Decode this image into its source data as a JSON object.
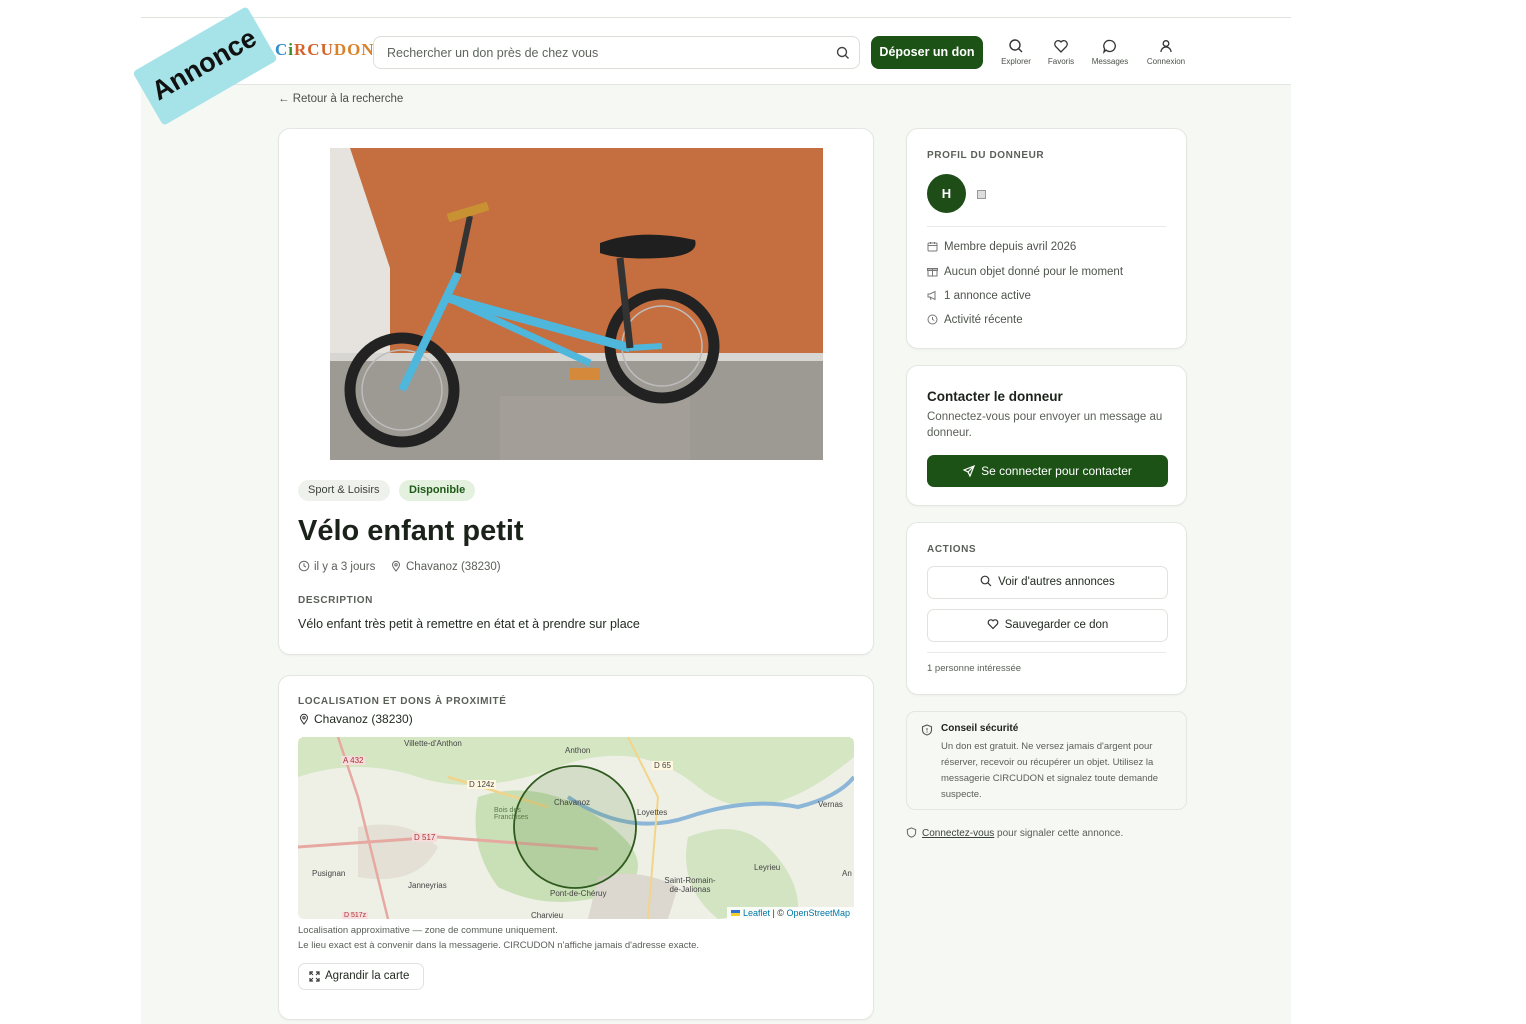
{
  "ad_ribbon": "Annonce",
  "brand": {
    "logo_c": "C",
    "logo_i": "i",
    "logo_r": "RCU",
    "logo_d": "DON"
  },
  "search": {
    "placeholder": "Rechercher un don près de chez vous"
  },
  "header": {
    "post_button": "Déposer un don",
    "nav": [
      {
        "label": "Explorer",
        "icon": "search-icon"
      },
      {
        "label": "Favoris",
        "icon": "heart-icon"
      },
      {
        "label": "Messages",
        "icon": "chat-icon"
      },
      {
        "label": "Connexion",
        "icon": "user-icon"
      }
    ]
  },
  "back_link": "← Retour à la recherche",
  "listing": {
    "category": "Sport & Loisirs",
    "status": "Disponible",
    "title": "Vélo enfant petit",
    "posted": "il y a 3 jours",
    "location": "Chavanoz (38230)",
    "description_label": "DESCRIPTION",
    "description": "Vélo enfant très petit à remettre en état et à prendre sur place"
  },
  "location_card": {
    "label": "LOCALISATION ET DONS À PROXIMITÉ",
    "place": "Chavanoz (38230)",
    "map_labels": [
      "Villette-d'Anthon",
      "A 432",
      "Anthon",
      "D 65",
      "D 124z",
      "Chavanoz",
      "Loyettes",
      "Vernas",
      "Bois des Franchises",
      "D 517",
      "Pusignan",
      "Janneyrias",
      "Pont-de-Chéruy",
      "Saint-Romain-de-Jalionas",
      "Leyrieu",
      "An",
      "Charvieu",
      "D 517z"
    ],
    "attribution_leaflet": "Leaflet",
    "attribution_sep": " | © ",
    "attribution_osm": "OpenStreetMap",
    "note1": "Localisation approximative — zone de commune uniquement.",
    "note2": "Le lieu exact est à convenir dans la messagerie. CIRCUDON n'affiche jamais d'adresse exacte.",
    "expand_button": "Agrandir la carte"
  },
  "profile": {
    "label": "PROFIL DU DONNEUR",
    "initial": "H",
    "stats": [
      {
        "icon": "calendar-icon",
        "text": "Membre depuis avril 2026"
      },
      {
        "icon": "gift-icon",
        "text": "Aucun objet donné pour le moment"
      },
      {
        "icon": "megaphone-icon",
        "text": "1 annonce active"
      },
      {
        "icon": "clock-icon",
        "text": "Activité récente"
      }
    ]
  },
  "contact": {
    "title": "Contacter le donneur",
    "subtitle": "Connectez-vous pour envoyer un message au donneur.",
    "button": "Se connecter pour contacter"
  },
  "actions": {
    "label": "ACTIONS",
    "see_others": "Voir d'autres annonces",
    "save": "Sauvegarder ce don",
    "interested": "1 personne intéressée"
  },
  "safety": {
    "title": "Conseil sécurité",
    "text": "Un don est gratuit. Ne versez jamais d'argent pour réserver, recevoir ou récupérer un objet. Utilisez la messagerie CIRCUDON et signalez toute demande suspecte."
  },
  "report": {
    "link": "Connectez-vous",
    "text": " pour signaler cette annonce."
  },
  "colors": {
    "brand_green": "#1d5217",
    "ribbon": "#a6e3e8",
    "page_bg": "#f6f8f3"
  }
}
